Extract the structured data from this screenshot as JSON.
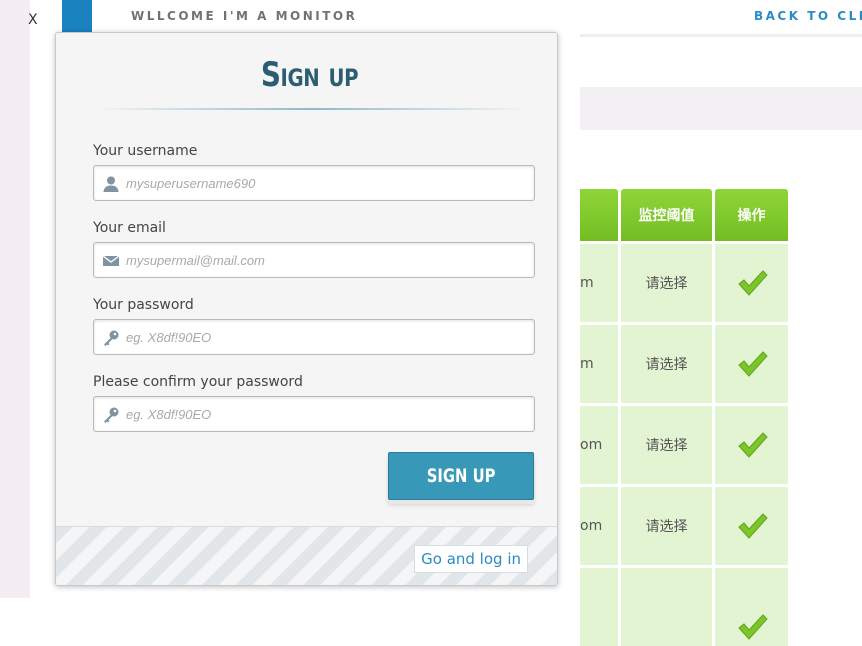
{
  "header": {
    "close_label": "X",
    "welcome_text": "WLLCOME I'M A MONITOR",
    "back_link": "BACK TO CLI"
  },
  "table": {
    "headers": [
      "监控阈值",
      "操作"
    ],
    "rows": [
      {
        "col1_tail": "m",
        "threshold": "请选择"
      },
      {
        "col1_tail": "m",
        "threshold": "请选择"
      },
      {
        "col1_tail": "om",
        "threshold": "请选择"
      },
      {
        "col1_tail": "om",
        "threshold": "请选择"
      },
      {
        "col1_tail": "",
        "threshold": ""
      }
    ]
  },
  "signup": {
    "title": "Sign up",
    "fields": [
      {
        "label": "Your username",
        "placeholder": "mysuperusername690",
        "icon": "user-icon"
      },
      {
        "label": "Your email",
        "placeholder": "mysupermail@mail.com",
        "icon": "mail-icon"
      },
      {
        "label": "Your password",
        "placeholder": "eg. X8df!90EO",
        "icon": "key-icon"
      },
      {
        "label": "Please confirm your password",
        "placeholder": "eg. X8df!90EO",
        "icon": "key-icon"
      }
    ],
    "submit_label": "SIGN UP",
    "login_link": "Go and log in"
  },
  "colors": {
    "accent_blue": "#3799b7",
    "title_color": "#2b5d73",
    "table_header_green": "#7dc52c",
    "table_cell_green": "#e3f4d3"
  }
}
